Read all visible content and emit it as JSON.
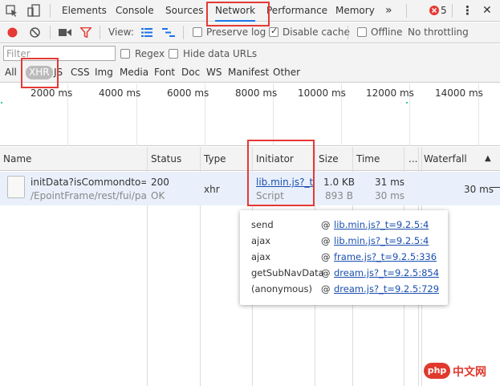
{
  "tabs": [
    {
      "label": "Elements"
    },
    {
      "label": "Console"
    },
    {
      "label": "Sources"
    },
    {
      "label": "Network"
    },
    {
      "label": "Performance"
    },
    {
      "label": "Memory"
    }
  ],
  "more_tabs": "»",
  "error_count": "5",
  "toolbar": {
    "view_label": "View:",
    "preserve_log": "Preserve log",
    "disable_cache": "Disable cache",
    "offline": "Offline",
    "throttling": "No throttling"
  },
  "filter": {
    "placeholder": "Filter",
    "regex": "Regex",
    "hide_data_urls": "Hide data URLs"
  },
  "type_filters": [
    "All",
    "XHR",
    "JS",
    "CSS",
    "Img",
    "Media",
    "Font",
    "Doc",
    "WS",
    "Manifest",
    "Other"
  ],
  "overview_ticks": [
    "2000 ms",
    "4000 ms",
    "6000 ms",
    "8000 ms",
    "10000 ms",
    "12000 ms",
    "14000 ms"
  ],
  "columns": {
    "name": "Name",
    "status": "Status",
    "type": "Type",
    "initiator": "Initiator",
    "size": "Size",
    "time": "Time",
    "more": "...",
    "waterfall": "Waterfall"
  },
  "request": {
    "name": "initData?isCommondto=t...",
    "path": "/EpointFrame/rest/fui/pa...",
    "status_code": "200",
    "status_text": "OK",
    "type": "xhr",
    "initiator": "lib.min.js?_t...",
    "initiator_type": "Script",
    "size": "1.0 KB",
    "size_resource": "893 B",
    "time": "31 ms",
    "latency": "30 ms",
    "waterfall_time": "30 ms"
  },
  "call_stack": [
    {
      "fn": "send",
      "at": "@",
      "src": "lib.min.js?_t=9.2.5:4"
    },
    {
      "fn": "ajax",
      "at": "@",
      "src": "lib.min.js?_t=9.2.5:4"
    },
    {
      "fn": "ajax",
      "at": "@",
      "src": "frame.js?_t=9.2.5:336"
    },
    {
      "fn": "getSubNavData",
      "at": "@",
      "src": "dream.js?_t=9.2.5:854"
    },
    {
      "fn": "(anonymous)",
      "at": "@",
      "src": "dream.js?_t=9.2.5:729"
    }
  ],
  "watermark": "php 中文网",
  "colors": {
    "record": "#e53935",
    "filter_icon": "#e53935",
    "error": "#e53935",
    "active_tab_underline": "#1a73e8",
    "link": "#1a4fb0",
    "highlight": "#e53935"
  }
}
